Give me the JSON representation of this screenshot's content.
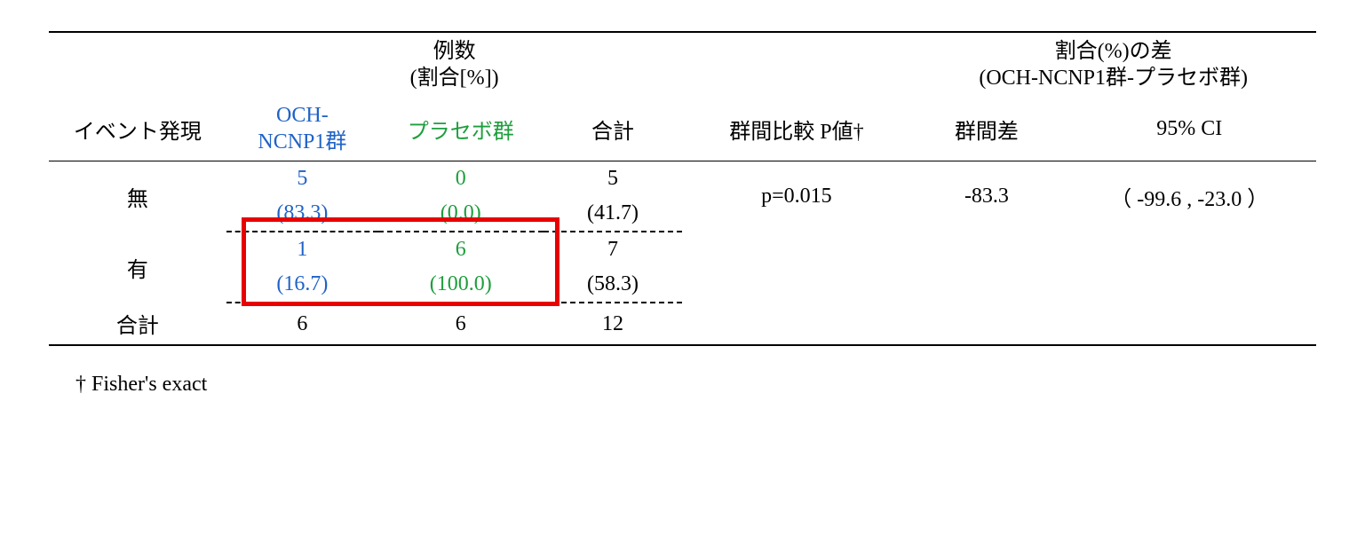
{
  "header": {
    "count_label_line1": "例数",
    "count_label_line2": "(割合[%])",
    "diff_label_line1": "割合(%)の差",
    "diff_label_line2": "(OCH-NCNP1群-プラセボ群)",
    "col_event": "イベント発現",
    "col_och_line1": "OCH-",
    "col_och_line2": "NCNP1群",
    "col_placebo": "プラセボ群",
    "col_total": "合計",
    "col_pvalue": "群間比較  P値†",
    "col_diff": "群間差",
    "col_ci": "95% CI"
  },
  "rows": {
    "none": {
      "label": "無",
      "och_n": "5",
      "och_pct": "(83.3)",
      "pbo_n": "0",
      "pbo_pct": "(0.0)",
      "tot_n": "5",
      "tot_pct": "(41.7)",
      "pvalue": "p=0.015",
      "diff": "-83.3",
      "ci": "（ -99.6 , -23.0 ）"
    },
    "yes": {
      "label": "有",
      "och_n": "1",
      "och_pct": "(16.7)",
      "pbo_n": "6",
      "pbo_pct": "(100.0)",
      "tot_n": "7",
      "tot_pct": "(58.3)"
    },
    "total": {
      "label": "合計",
      "och": "6",
      "pbo": "6",
      "tot": "12"
    }
  },
  "footnote": "† Fisher's exact"
}
